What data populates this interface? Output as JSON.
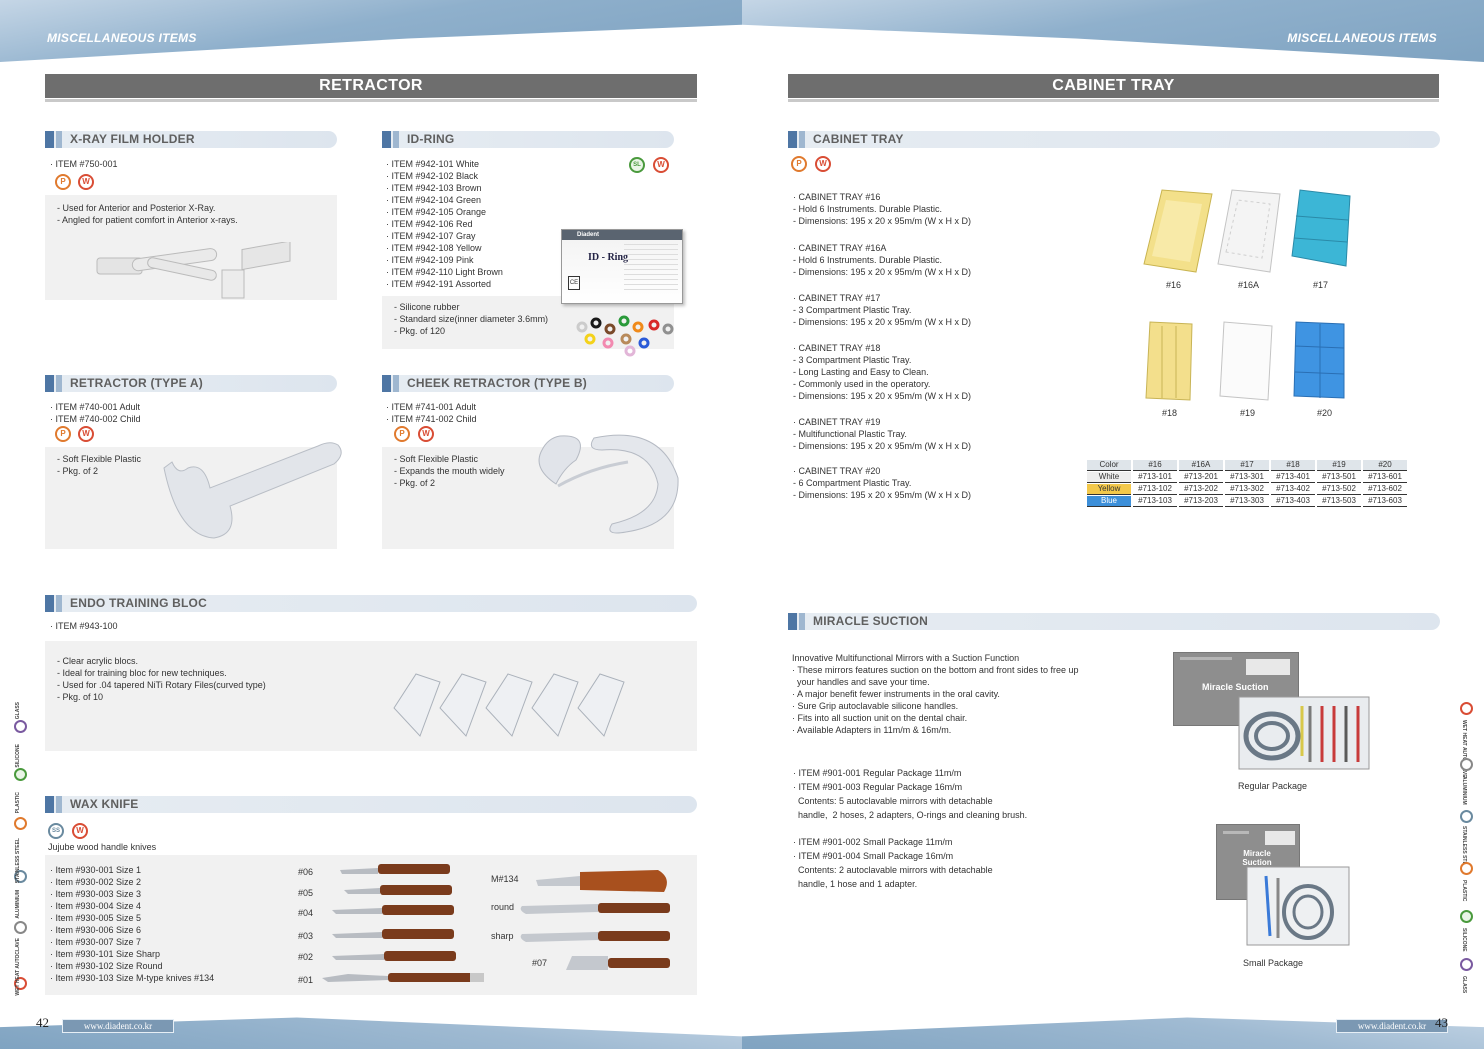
{
  "header": {
    "left_category": "MISCELLANEOUS ITEMS",
    "right_category": "MISCELLANEOUS ITEMS"
  },
  "footer": {
    "left_page": "42",
    "right_page": "43",
    "url": "www.diadent.co.kr"
  },
  "left": {
    "title": "RETRACTOR",
    "xray": {
      "heading": "X-RAY FILM HOLDER",
      "items": [
        "· ITEM #750-001"
      ],
      "desc": [
        "- Used for Anterior and Posterior X-Ray.",
        "- Angled for patient comfort in Anterior x-rays."
      ]
    },
    "idring": {
      "heading": "ID-RING",
      "items": [
        "· ITEM #942-101 White",
        "· ITEM #942-102 Black",
        "· ITEM #942-103 Brown",
        "· ITEM #942-104 Green",
        "· ITEM #942-105 Orange",
        "· ITEM #942-106 Red",
        "· ITEM #942-107 Gray",
        "· ITEM #942-108 Yellow",
        "· ITEM #942-109 Pink",
        "· ITEM #942-110 Light Brown",
        "· ITEM #942-191 Assorted"
      ],
      "desc": [
        "- Silicone rubber",
        "- Standard size(inner diameter 3.6mm)",
        "- Pkg. of 120"
      ],
      "box_brand": "Diadent",
      "box_label": "ID - Ring",
      "ring_colors": [
        "#ffffff",
        "#1a1a1a",
        "#7a4a2a",
        "#2a9a3a",
        "#f08a1a",
        "#d82828",
        "#909090",
        "#f4d21a",
        "#f28ab0",
        "#b88a5a",
        "#2a5ad8",
        "#e2b6d8"
      ]
    },
    "retractor_a": {
      "heading": "RETRACTOR (TYPE A)",
      "items": [
        "· ITEM #740-001 Adult",
        "· ITEM #740-002 Child"
      ],
      "desc": [
        "- Soft Flexible Plastic",
        "- Pkg. of 2"
      ]
    },
    "cheek": {
      "heading": "CHEEK RETRACTOR (TYPE B)",
      "items": [
        "· ITEM #741-001 Adult",
        "· ITEM #741-002 Child"
      ],
      "desc": [
        "- Soft Flexible Plastic",
        "- Expands the mouth widely",
        "- Pkg. of 2"
      ]
    },
    "endo": {
      "heading": "ENDO TRAINING BLOC",
      "items": [
        "· ITEM #943-100"
      ],
      "desc": [
        "- Clear acrylic blocs.",
        "- Ideal for training bloc for new techniques.",
        "- Used for .04 tapered NiTi Rotary Files(curved type)",
        "- Pkg. of 10"
      ]
    },
    "wax": {
      "heading": "WAX KNIFE",
      "subtitle": "Jujube wood handle knives",
      "items": [
        "· Item #930-001 Size 1",
        "· Item #930-002 Size 2",
        "· Item #930-003 Size 3",
        "· Item #930-004 Size 4",
        "· Item #930-005 Size 5",
        "· Item #930-006 Size 6",
        "· Item #930-007 Size 7",
        "· Item #930-101 Size Sharp",
        "· Item #930-102 Size Round",
        "· Item #930-103 Size M-type knives #134"
      ],
      "left_labels": [
        "#06",
        "#05",
        "#04",
        "#03",
        "#02",
        "#01"
      ],
      "right_labels": [
        "M#134",
        "round",
        "sharp",
        "#07"
      ]
    }
  },
  "right": {
    "title": "CABINET TRAY",
    "cabinet": {
      "heading": "CABINET TRAY",
      "entries": [
        {
          "name": "· CABINET TRAY #16",
          "lines": [
            "- Hold 6 Instruments. Durable Plastic.",
            "- Dimensions: 195 x 20 x 95m/m (W x H x D)"
          ]
        },
        {
          "name": "· CABINET TRAY #16A",
          "lines": [
            "- Hold 6 Instruments. Durable Plastic.",
            "- Dimensions: 195 x 20 x 95m/m (W x H x D)"
          ]
        },
        {
          "name": "· CABINET TRAY #17",
          "lines": [
            "- 3 Compartment Plastic Tray.",
            "- Dimensions: 195 x 20 x 95m/m (W x H x D)"
          ]
        },
        {
          "name": "· CABINET TRAY #18",
          "lines": [
            "- 3 Compartment Plastic Tray.",
            "- Long Lasting and Easy to Clean.",
            "- Commonly used in the operatory.",
            "- Dimensions: 195 x 20 x 95m/m (W x H x D)"
          ]
        },
        {
          "name": "· CABINET TRAY #19",
          "lines": [
            "- Multifunctional Plastic Tray.",
            "- Dimensions: 195 x 20 x 95m/m (W x H x D)"
          ]
        },
        {
          "name": "· CABINET TRAY #20",
          "lines": [
            "- 6 Compartment Plastic Tray.",
            "- Dimensions: 195 x 20 x 95m/m (W x H x D)"
          ]
        }
      ],
      "photo_labels": [
        "#16",
        "#16A",
        "#17",
        "#18",
        "#19",
        "#20"
      ],
      "table": {
        "headers": [
          "Color",
          "#16",
          "#16A",
          "#17",
          "#18",
          "#19",
          "#20"
        ],
        "rows": [
          [
            "White",
            "#713-101",
            "#713-201",
            "#713-301",
            "#713-401",
            "#713-501",
            "#713-601"
          ],
          [
            "Yellow",
            "#713-102",
            "#713-202",
            "#713-302",
            "#713-402",
            "#713-502",
            "#713-602"
          ],
          [
            "Blue",
            "#713-103",
            "#713-203",
            "#713-303",
            "#713-403",
            "#713-503",
            "#713-603"
          ]
        ]
      }
    },
    "suction": {
      "heading": "MIRACLE SUCTION",
      "intro": [
        "Innovative Multifunctional Mirrors with a Suction Function",
        "· These mirrors features suction on the bottom and front sides to free up",
        "  your handles and save your time.",
        "· A major benefit fewer instruments in the oral cavity.",
        "· Sure Grip autoclavable silicone handles.",
        "· Fits into all suction unit on the dental chair.",
        "· Available Adapters in 11m/m & 16m/m."
      ],
      "regular": [
        "· ITEM #901-001 Regular Package 11m/m",
        "· ITEM #901-003 Regular Package 16m/m",
        "  Contents: 5 autoclavable mirrors with detachable",
        "  handle,  2 hoses, 2 adapters, O-rings and cleaning brush."
      ],
      "small": [
        "· ITEM #901-002 Small Package 11m/m",
        "· ITEM #901-004 Small Package 16m/m",
        "  Contents: 2 autoclavable mirrors with detachable",
        "  handle, 1 hose and 1 adapter."
      ],
      "regular_caption": "Regular Package",
      "small_caption": "Small Package",
      "box_text": "Miracle Suction",
      "small_box_text": "Miracle Suction"
    }
  },
  "sidebar": {
    "left_labels": [
      "WET HEAT AUTOCLAVE",
      "ALUMINIUM",
      "STAINLESS STEEL",
      "PLASTIC",
      "SILICONE",
      "GLASS"
    ],
    "right_labels": [
      "WET HEAT AUTOCLAVE",
      "ALUMINIUM",
      "STAINLESS STEEL",
      "PLASTIC",
      "SILICONE",
      "GLASS"
    ]
  },
  "badges": {
    "plastic": "P",
    "autoclave": "W",
    "silicone": "SL",
    "steel": "SS"
  }
}
